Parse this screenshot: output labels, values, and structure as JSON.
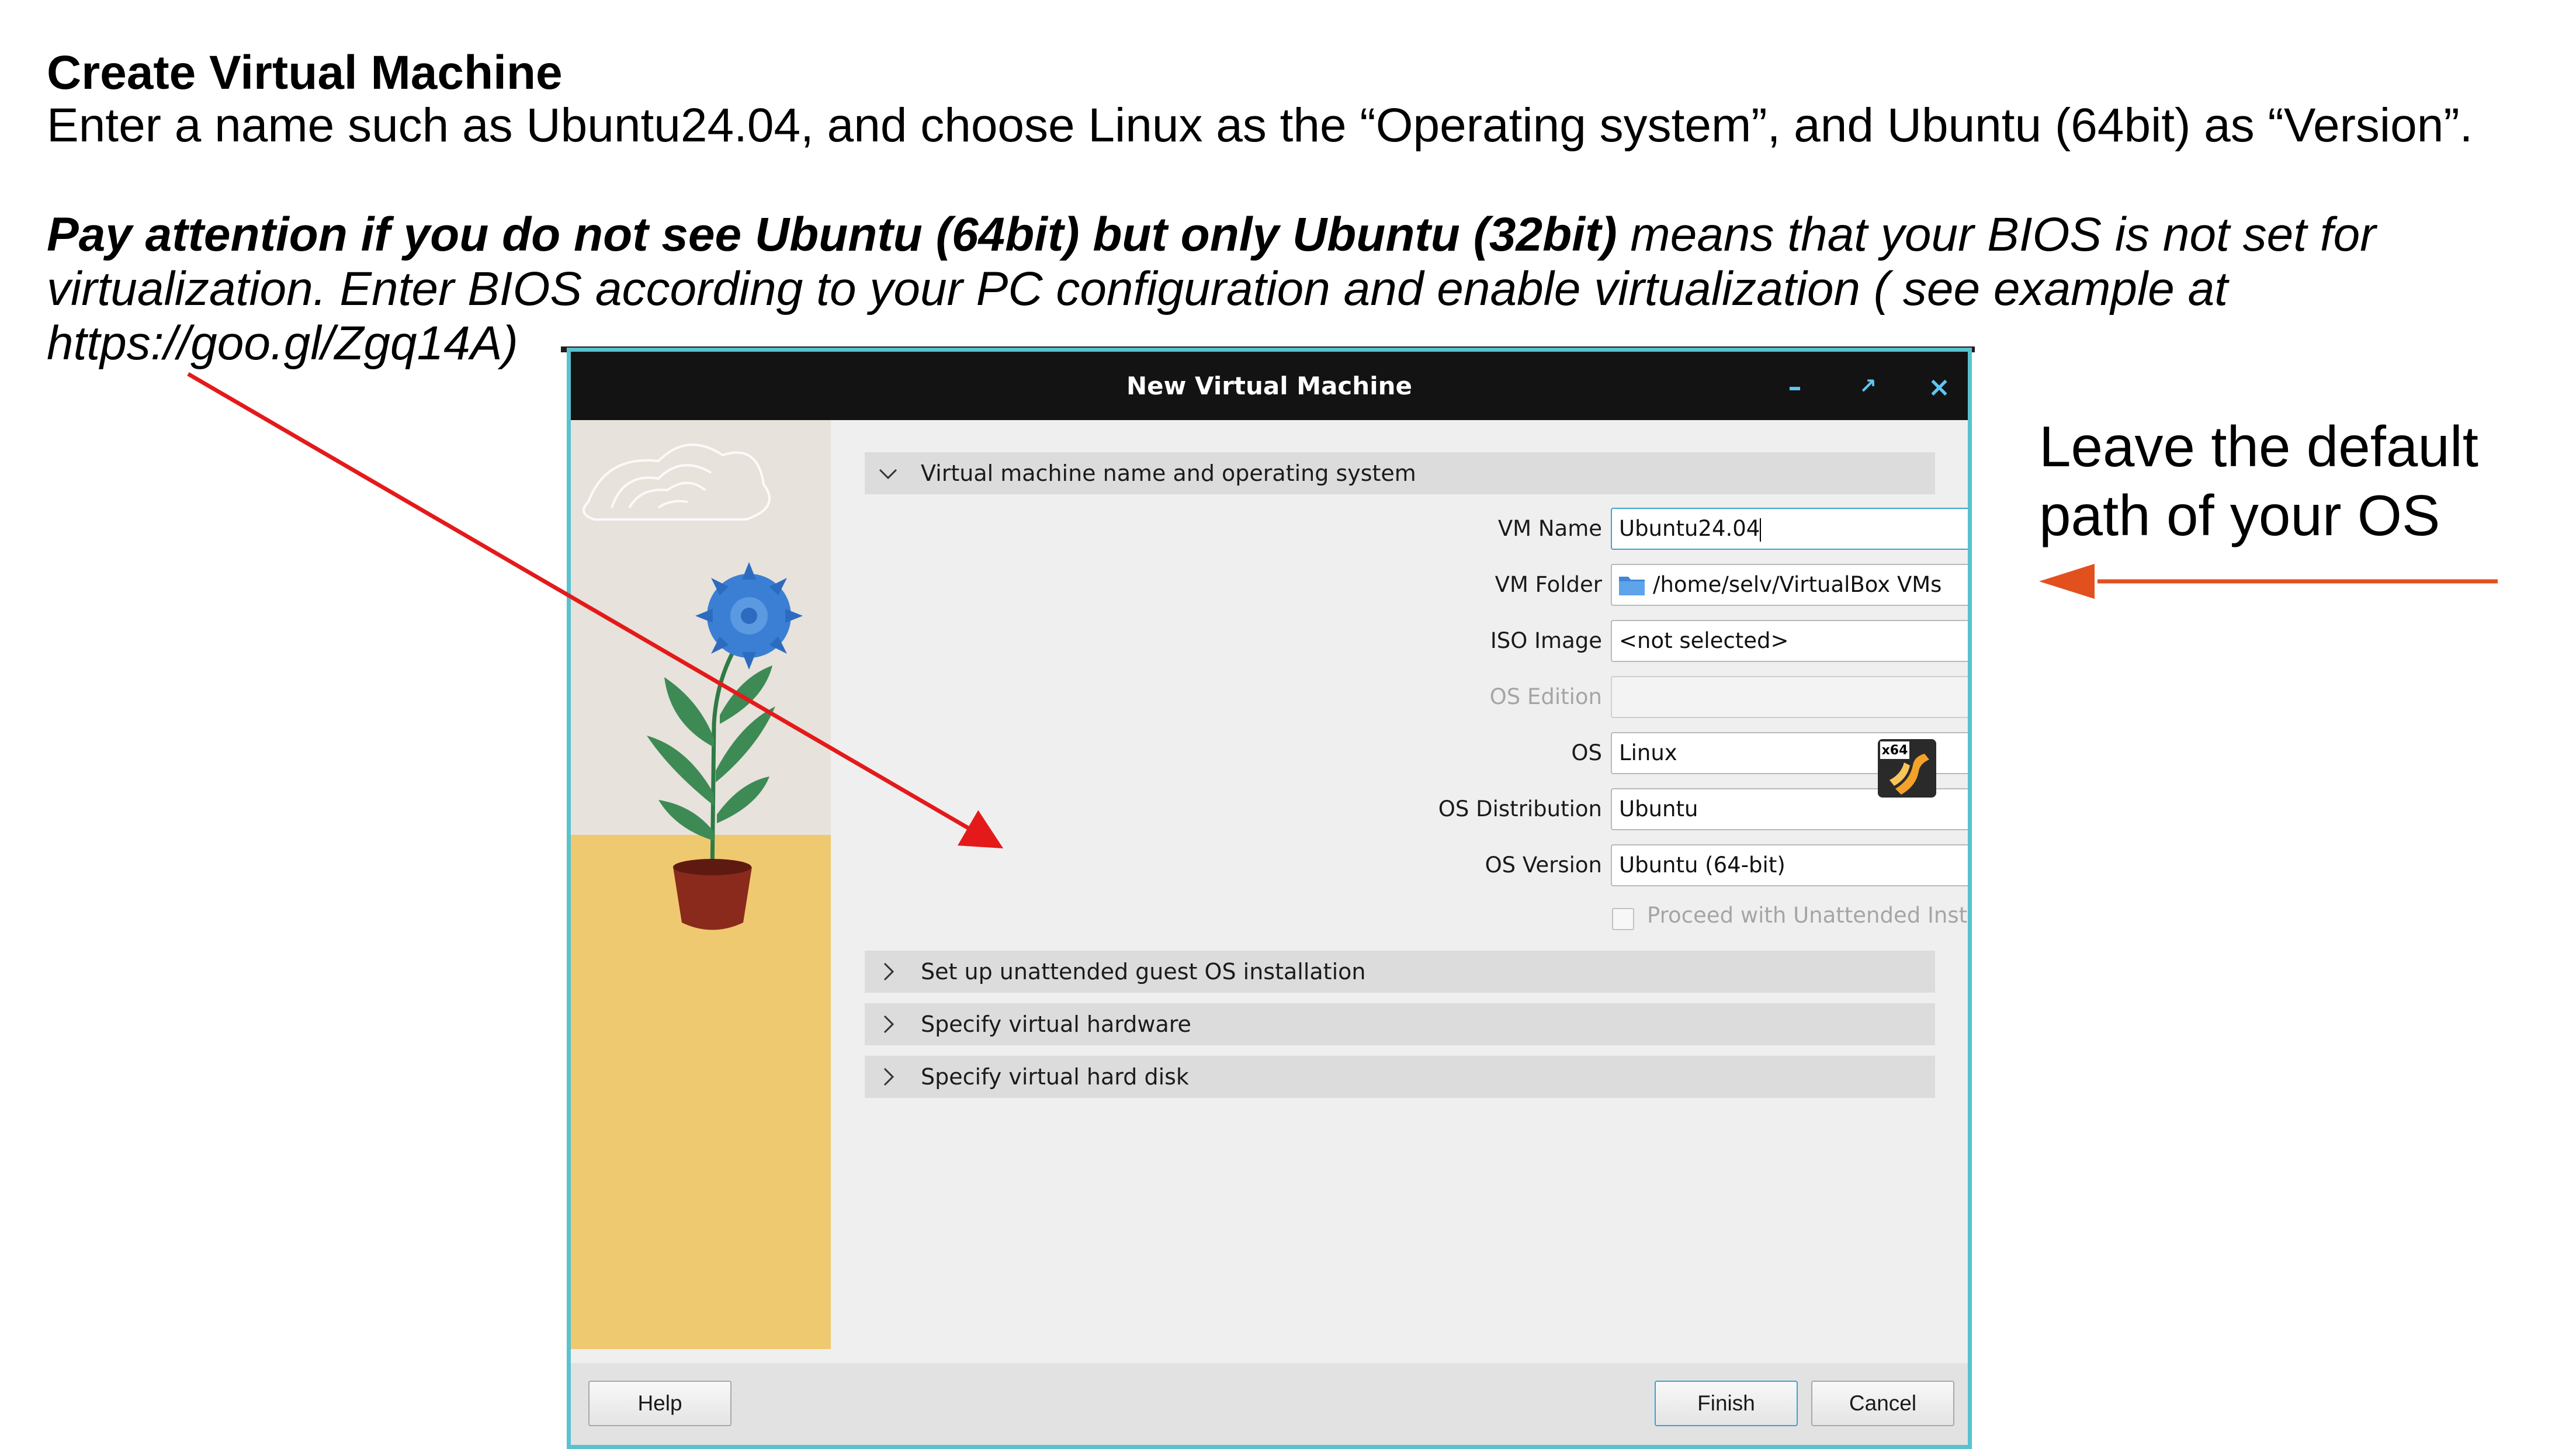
{
  "slide": {
    "title": "Create Virtual Machine",
    "line1": "Enter a name such as Ubuntu24.04, and choose Linux as the “Operating system”, and Ubuntu (64bit) as “Version”.",
    "warn_bold": "Pay attention if you do not see Ubuntu (64bit) but only Ubuntu (32bit)",
    "warn_rest": " means that your BIOS is not set for virtualization. Enter BIOS according to your PC configuration and enable virtualization ( see example at https://goo.gl/Zgq14A)",
    "side_note": "Leave the default path of your OS"
  },
  "dialog": {
    "title": "New Virtual Machine",
    "sections": {
      "name_os": "Virtual machine name and operating system",
      "unattended": "Set up unattended guest OS installation",
      "hardware": "Specify virtual hardware",
      "hard_disk": "Specify virtual hard disk"
    },
    "fields": {
      "vm_name": {
        "label": "VM Name",
        "value": "Ubuntu24.04"
      },
      "vm_folder": {
        "label": "VM Folder",
        "value": "/home/selv/VirtualBox VMs"
      },
      "iso_image": {
        "label": "ISO Image",
        "value": "<not selected>"
      },
      "os_edition": {
        "label": "OS Edition",
        "value": ""
      },
      "os": {
        "label": "OS",
        "value": "Linux"
      },
      "os_distribution": {
        "label": "OS Distribution",
        "value": "Ubuntu"
      },
      "os_version": {
        "label": "OS Version",
        "value": "Ubuntu (64-bit)"
      }
    },
    "os_badge_text": "x64",
    "unattended_checkbox": {
      "label": "Proceed with Unattended Installation",
      "checked": false
    },
    "buttons": {
      "help": "Help",
      "finish": "Finish",
      "cancel": "Cancel"
    }
  },
  "colors": {
    "window_border": "#58c2cf",
    "titlebar": "#131313",
    "arrow_red": "#e41a1a",
    "arrow_orange": "#e2501e"
  }
}
